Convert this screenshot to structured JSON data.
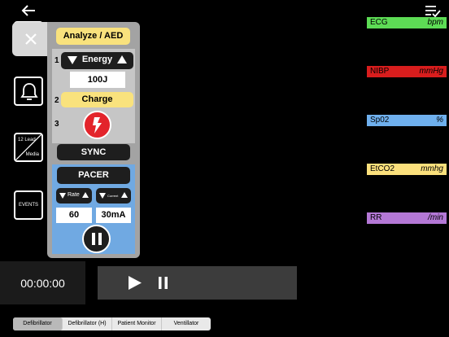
{
  "left_buttons": {
    "lead_line1": "12 Lead",
    "lead_line2": "Media",
    "events": "EVENTS"
  },
  "defib": {
    "analyze_label": "Analyze / AED",
    "step1": "1",
    "step2": "2",
    "step3": "3",
    "energy_label": "Energy",
    "energy_value": "100J",
    "charge_label": "Charge",
    "sync_label": "SYNC"
  },
  "pacer": {
    "label": "PACER",
    "rate_label": "Rate",
    "current_label": "Current",
    "rate_value": "60",
    "current_value": "30mA"
  },
  "timer": "00:00:00",
  "vitals": [
    {
      "name": "ECG",
      "unit": "bpm",
      "color": "#5ddc55"
    },
    {
      "name": "NIBP",
      "unit": "mmHg",
      "color": "#d81d1d"
    },
    {
      "name": "Sp02",
      "unit": "%",
      "color": "#6fb0ee"
    },
    {
      "name": "EtCO2",
      "unit": "mmhg",
      "color": "#fbe07c"
    },
    {
      "name": "RR",
      "unit": "/min",
      "color": "#b478d6"
    }
  ],
  "tabs": [
    {
      "label": "Defibrillator",
      "active": true
    },
    {
      "label": "Defibrillator (H)",
      "active": false
    },
    {
      "label": "Patient Monitor",
      "active": false
    },
    {
      "label": "Ventillator",
      "active": false
    }
  ],
  "colors": {
    "charge": "#f9e27d",
    "shock": "#e3242b",
    "pacer_section": "#70a9e2"
  }
}
